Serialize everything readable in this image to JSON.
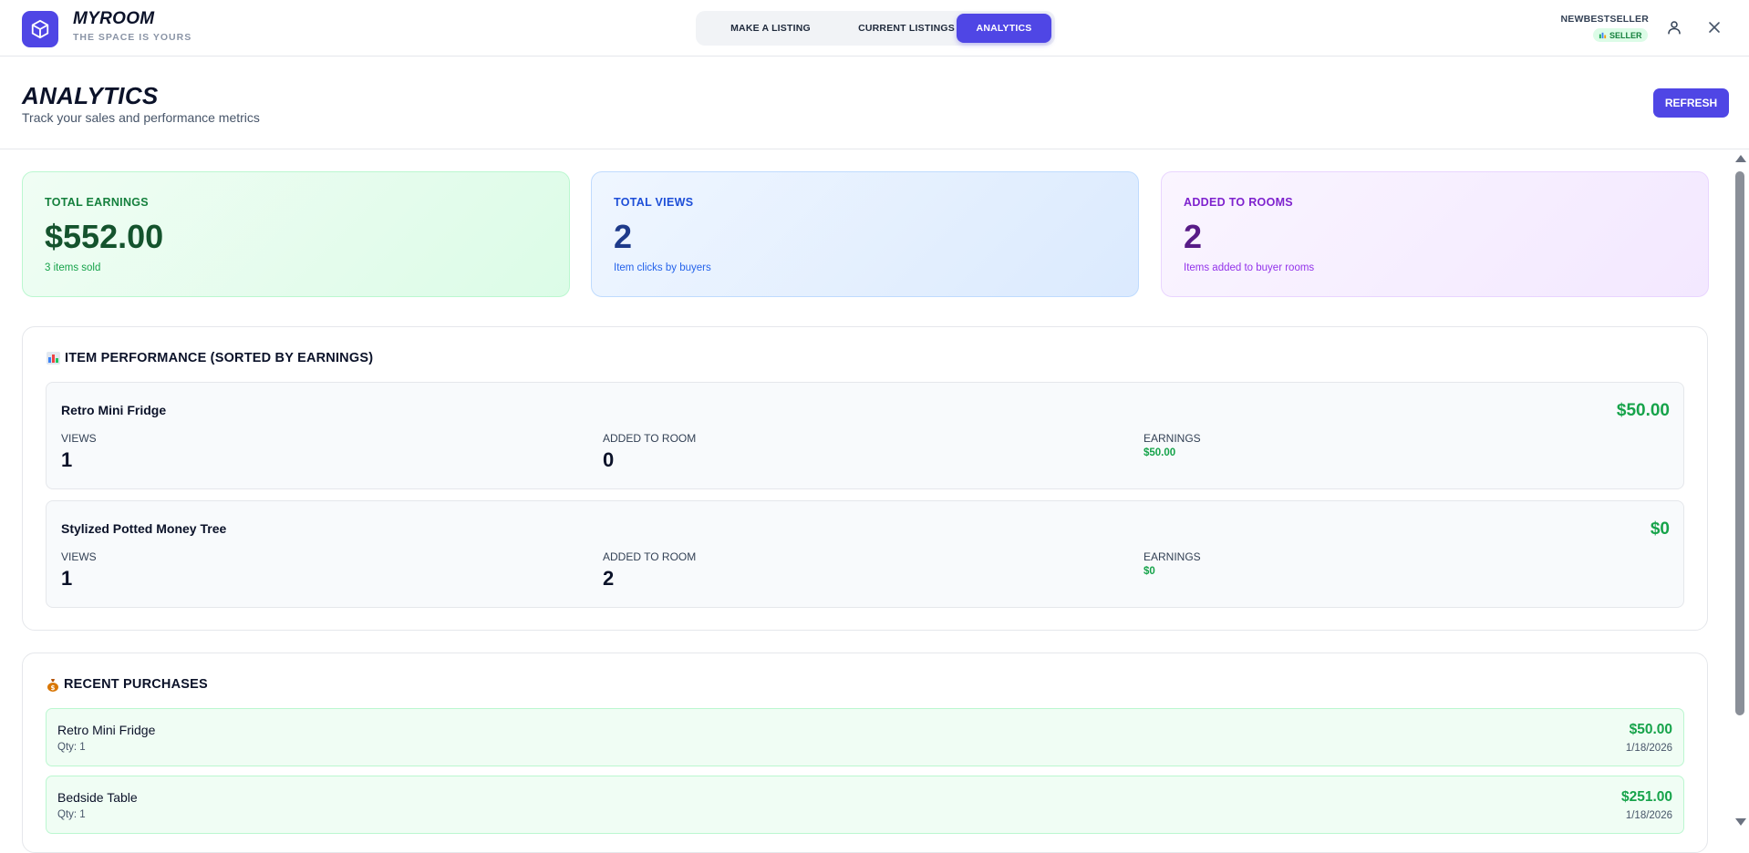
{
  "brand": {
    "name": "MYROOM",
    "tagline": "THE SPACE IS YOURS"
  },
  "nav": {
    "tabs": [
      {
        "label": "MAKE A LISTING",
        "active": false
      },
      {
        "label": "CURRENT LISTINGS",
        "active": false
      },
      {
        "label": "ANALYTICS",
        "active": true
      }
    ]
  },
  "user": {
    "name": "NEWBESTSELLER",
    "role_badge": "SELLER"
  },
  "page": {
    "title": "ANALYTICS",
    "subtitle": "Track your sales and performance metrics",
    "refresh_label": "REFRESH"
  },
  "stats": [
    {
      "label": "TOTAL EARNINGS",
      "value": "$552.00",
      "note": "3 items sold",
      "color": "#16a34a"
    },
    {
      "label": "TOTAL VIEWS",
      "value": "2",
      "note": "Item clicks by buyers",
      "color": "#2563eb"
    },
    {
      "label": "ADDED TO ROOMS",
      "value": "2",
      "note": "Items added to buyer rooms",
      "color": "#9333ea"
    }
  ],
  "performance": {
    "title": "ITEM PERFORMANCE (SORTED BY EARNINGS)",
    "icon": "bar-chart-emoji",
    "views_label": "VIEWS",
    "added_label": "ADDED TO ROOM",
    "earnings_label": "EARNINGS",
    "items": [
      {
        "name": "Retro Mini Fridge",
        "total": "$50.00",
        "views": "1",
        "added": "0",
        "earnings": "$50.00"
      },
      {
        "name": "Stylized Potted Money Tree",
        "total": "$0",
        "views": "1",
        "added": "2",
        "earnings": "$0"
      }
    ]
  },
  "purchases": {
    "title": "RECENT PURCHASES",
    "icon": "money-bag-emoji",
    "items": [
      {
        "name": "Retro Mini Fridge",
        "qty": "Qty: 1",
        "amount": "$50.00",
        "date": "1/18/2026"
      },
      {
        "name": "Bedside Table",
        "qty": "Qty: 1",
        "amount": "$251.00",
        "date": "1/18/2026"
      }
    ]
  },
  "colors": {
    "accent": "#4f46e5",
    "money": "#16a34a"
  }
}
